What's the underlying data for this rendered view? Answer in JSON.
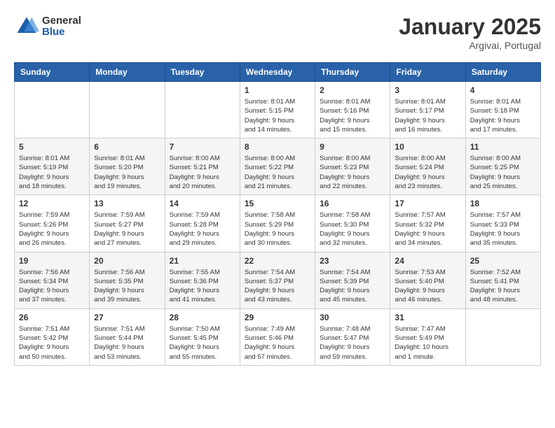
{
  "header": {
    "logo_general": "General",
    "logo_blue": "Blue",
    "month_title": "January 2025",
    "location": "Argivai, Portugal"
  },
  "days_of_week": [
    "Sunday",
    "Monday",
    "Tuesday",
    "Wednesday",
    "Thursday",
    "Friday",
    "Saturday"
  ],
  "weeks": [
    [
      {
        "day": "",
        "info": ""
      },
      {
        "day": "",
        "info": ""
      },
      {
        "day": "",
        "info": ""
      },
      {
        "day": "1",
        "info": "Sunrise: 8:01 AM\nSunset: 5:15 PM\nDaylight: 9 hours\nand 14 minutes."
      },
      {
        "day": "2",
        "info": "Sunrise: 8:01 AM\nSunset: 5:16 PM\nDaylight: 9 hours\nand 15 minutes."
      },
      {
        "day": "3",
        "info": "Sunrise: 8:01 AM\nSunset: 5:17 PM\nDaylight: 9 hours\nand 16 minutes."
      },
      {
        "day": "4",
        "info": "Sunrise: 8:01 AM\nSunset: 5:18 PM\nDaylight: 9 hours\nand 17 minutes."
      }
    ],
    [
      {
        "day": "5",
        "info": "Sunrise: 8:01 AM\nSunset: 5:19 PM\nDaylight: 9 hours\nand 18 minutes."
      },
      {
        "day": "6",
        "info": "Sunrise: 8:01 AM\nSunset: 5:20 PM\nDaylight: 9 hours\nand 19 minutes."
      },
      {
        "day": "7",
        "info": "Sunrise: 8:00 AM\nSunset: 5:21 PM\nDaylight: 9 hours\nand 20 minutes."
      },
      {
        "day": "8",
        "info": "Sunrise: 8:00 AM\nSunset: 5:22 PM\nDaylight: 9 hours\nand 21 minutes."
      },
      {
        "day": "9",
        "info": "Sunrise: 8:00 AM\nSunset: 5:23 PM\nDaylight: 9 hours\nand 22 minutes."
      },
      {
        "day": "10",
        "info": "Sunrise: 8:00 AM\nSunset: 5:24 PM\nDaylight: 9 hours\nand 23 minutes."
      },
      {
        "day": "11",
        "info": "Sunrise: 8:00 AM\nSunset: 5:25 PM\nDaylight: 9 hours\nand 25 minutes."
      }
    ],
    [
      {
        "day": "12",
        "info": "Sunrise: 7:59 AM\nSunset: 5:26 PM\nDaylight: 9 hours\nand 26 minutes."
      },
      {
        "day": "13",
        "info": "Sunrise: 7:59 AM\nSunset: 5:27 PM\nDaylight: 9 hours\nand 27 minutes."
      },
      {
        "day": "14",
        "info": "Sunrise: 7:59 AM\nSunset: 5:28 PM\nDaylight: 9 hours\nand 29 minutes."
      },
      {
        "day": "15",
        "info": "Sunrise: 7:58 AM\nSunset: 5:29 PM\nDaylight: 9 hours\nand 30 minutes."
      },
      {
        "day": "16",
        "info": "Sunrise: 7:58 AM\nSunset: 5:30 PM\nDaylight: 9 hours\nand 32 minutes."
      },
      {
        "day": "17",
        "info": "Sunrise: 7:57 AM\nSunset: 5:32 PM\nDaylight: 9 hours\nand 34 minutes."
      },
      {
        "day": "18",
        "info": "Sunrise: 7:57 AM\nSunset: 5:33 PM\nDaylight: 9 hours\nand 35 minutes."
      }
    ],
    [
      {
        "day": "19",
        "info": "Sunrise: 7:56 AM\nSunset: 5:34 PM\nDaylight: 9 hours\nand 37 minutes."
      },
      {
        "day": "20",
        "info": "Sunrise: 7:56 AM\nSunset: 5:35 PM\nDaylight: 9 hours\nand 39 minutes."
      },
      {
        "day": "21",
        "info": "Sunrise: 7:55 AM\nSunset: 5:36 PM\nDaylight: 9 hours\nand 41 minutes."
      },
      {
        "day": "22",
        "info": "Sunrise: 7:54 AM\nSunset: 5:37 PM\nDaylight: 9 hours\nand 43 minutes."
      },
      {
        "day": "23",
        "info": "Sunrise: 7:54 AM\nSunset: 5:39 PM\nDaylight: 9 hours\nand 45 minutes."
      },
      {
        "day": "24",
        "info": "Sunrise: 7:53 AM\nSunset: 5:40 PM\nDaylight: 9 hours\nand 46 minutes."
      },
      {
        "day": "25",
        "info": "Sunrise: 7:52 AM\nSunset: 5:41 PM\nDaylight: 9 hours\nand 48 minutes."
      }
    ],
    [
      {
        "day": "26",
        "info": "Sunrise: 7:51 AM\nSunset: 5:42 PM\nDaylight: 9 hours\nand 50 minutes."
      },
      {
        "day": "27",
        "info": "Sunrise: 7:51 AM\nSunset: 5:44 PM\nDaylight: 9 hours\nand 53 minutes."
      },
      {
        "day": "28",
        "info": "Sunrise: 7:50 AM\nSunset: 5:45 PM\nDaylight: 9 hours\nand 55 minutes."
      },
      {
        "day": "29",
        "info": "Sunrise: 7:49 AM\nSunset: 5:46 PM\nDaylight: 9 hours\nand 57 minutes."
      },
      {
        "day": "30",
        "info": "Sunrise: 7:48 AM\nSunset: 5:47 PM\nDaylight: 9 hours\nand 59 minutes."
      },
      {
        "day": "31",
        "info": "Sunrise: 7:47 AM\nSunset: 5:49 PM\nDaylight: 10 hours\nand 1 minute."
      },
      {
        "day": "",
        "info": ""
      }
    ]
  ]
}
